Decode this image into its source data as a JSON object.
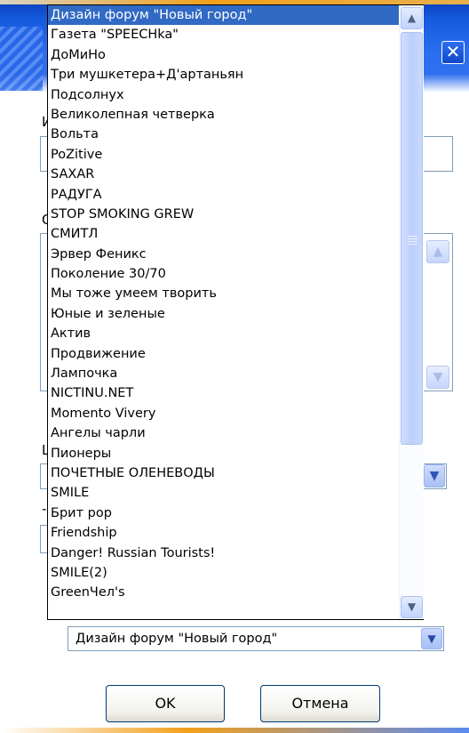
{
  "dialog": {
    "close_icon": "close-icon"
  },
  "dropdown": {
    "selected_index": 0,
    "items": [
      "Дизайн форум \"Новый город\"",
      "Газета \"SPEECHka\"",
      "ДоМиНо",
      "Три мушкетера+Д'артаньян",
      "Подсолнух",
      "Великолепная четверка",
      "Вольта",
      "PoZitive",
      "SAXAR",
      "РАДУГА",
      "STOP SMOKING GREW",
      "СМИТЛ",
      "Эрвер Феникс",
      "Поколение 30/70",
      "Мы тоже умеем творить",
      "Юные и зеленые",
      "Актив",
      "Продвижение",
      "Лампочка",
      "NICTINU.NET",
      "Momento Vivery",
      "Ангелы чарли",
      "Пионеры",
      "ПОЧЕТНЫЕ ОЛЕНЕВОДЫ",
      "SMILE",
      "Брит рор",
      "Friendship",
      "Danger! Russian Tourists!",
      "SMILE(2)",
      "GreenЧел's"
    ],
    "scroll_up_icon": "arrow-up-icon",
    "scroll_down_icon": "arrow-down-icon"
  },
  "combo": {
    "value": "Дизайн форум \"Новый город\"",
    "arrow_icon": "chevron-down-icon"
  },
  "buttons": {
    "ok_label": "OK",
    "cancel_label": "Отмена"
  }
}
